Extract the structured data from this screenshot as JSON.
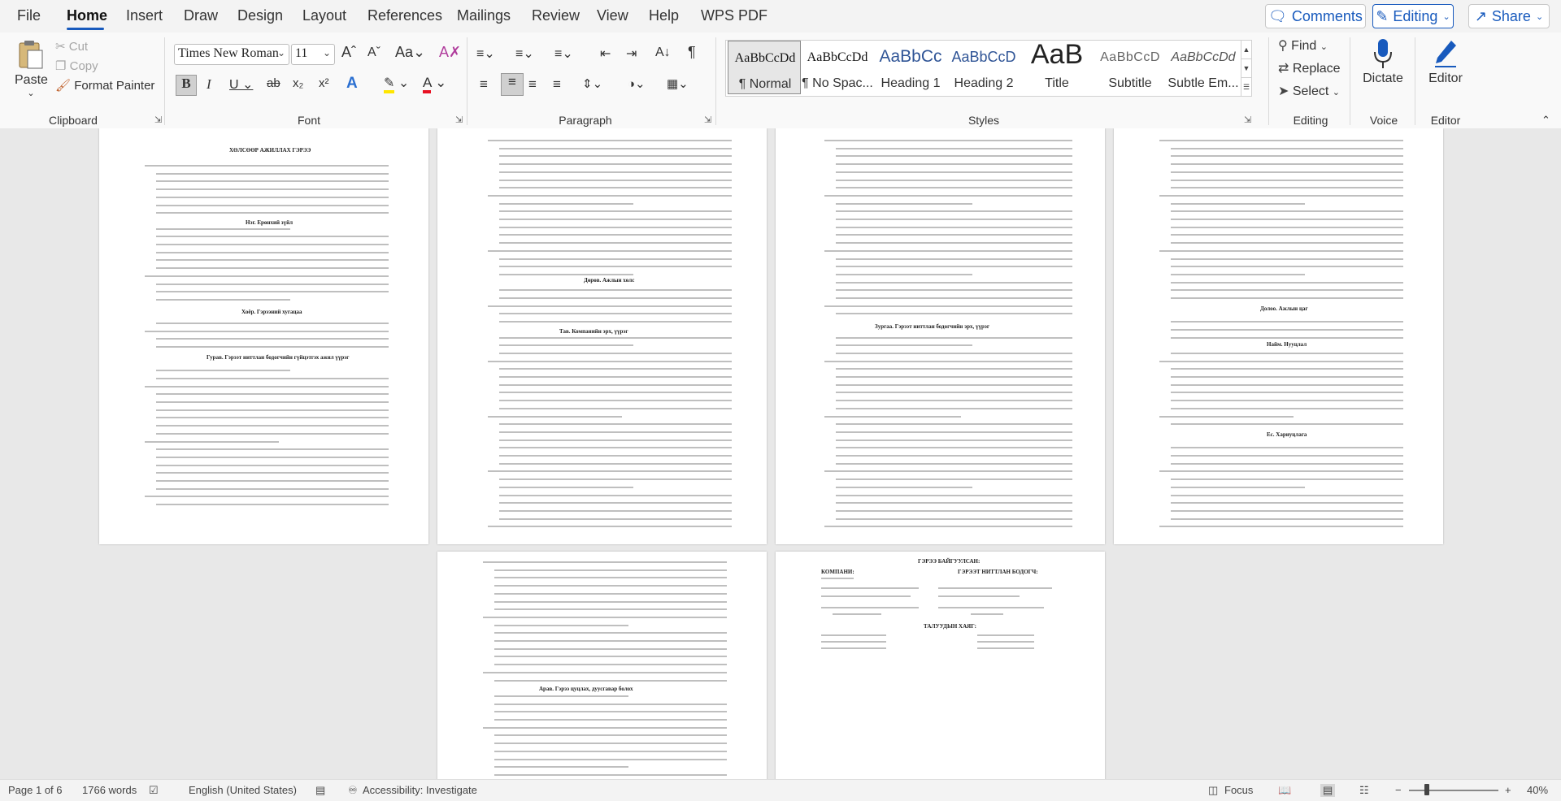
{
  "menu": {
    "file": "File",
    "home": "Home",
    "insert": "Insert",
    "draw": "Draw",
    "design": "Design",
    "layout": "Layout",
    "references": "References",
    "mailings": "Mailings",
    "review": "Review",
    "view": "View",
    "help": "Help",
    "wps_pdf": "WPS PDF"
  },
  "top_buttons": {
    "comments": "Comments",
    "editing": "Editing",
    "share": "Share"
  },
  "clipboard": {
    "paste": "Paste",
    "cut": "Cut",
    "copy": "Copy",
    "format_painter": "Format Painter",
    "label": "Clipboard"
  },
  "font": {
    "name": "Times New Roman",
    "size": "11",
    "label": "Font"
  },
  "paragraph": {
    "label": "Paragraph"
  },
  "styles": {
    "label": "Styles",
    "items": [
      {
        "preview": "AaBbCcDd",
        "name": "¶ Normal"
      },
      {
        "preview": "AaBbCcDd",
        "name": "¶ No Spac..."
      },
      {
        "preview": "AaBbCc",
        "name": "Heading 1"
      },
      {
        "preview": "AaBbCcD",
        "name": "Heading 2"
      },
      {
        "preview": "AaB",
        "name": "Title"
      },
      {
        "preview": "AaBbCcD",
        "name": "Subtitle"
      },
      {
        "preview": "AaBbCcDd",
        "name": "Subtle Em..."
      }
    ]
  },
  "editing": {
    "find": "Find",
    "replace": "Replace",
    "select": "Select",
    "label": "Editing"
  },
  "voice": {
    "dictate": "Dictate",
    "label": "Voice"
  },
  "editor": {
    "editor": "Editor",
    "label": "Editor"
  },
  "document": {
    "page1_title": "ХӨЛСӨӨР АЖИЛЛАХ ГЭРЭЭ",
    "page1_h1": "Нэг. Ерөнхий зүйл",
    "page1_h2": "Хоёр. Гэрээний хугацаа",
    "page1_h3": "Гурав. Гэрээт ниттлан бодогчийн гүйцэтгэх ажил үүрэг",
    "page2_h1": "Дөрөв. Ажлын хөлс",
    "page2_h2": "Тав. Компанийн эрх, үүрэг",
    "page3_h1": "Зургаа. Гэрээт ниттлан бодогчийн эрх, үүрэг",
    "page4_h1": "Долоо. Ажлын цаг",
    "page4_h2": "Найм. Нууцлал",
    "page4_h3": "Ес. Хариуцлага",
    "page5_h1": "Арав. Гэрээ цуцлах, дуусгавар болох",
    "page6_title": "ГЭРЭЭ БАЙГУУЛСАН:",
    "page6_company": "КОМПАНИ:",
    "page6_accountant": "ГЭРЭЭТ НИТТЛАН БОДОГЧ:",
    "page6_contacts": "ТАЛУУДЫН ХАЯГ:"
  },
  "status": {
    "page": "Page 1 of 6",
    "words": "1766 words",
    "language": "English (United States)",
    "accessibility": "Accessibility: Investigate",
    "focus": "Focus",
    "zoom": "40%"
  }
}
